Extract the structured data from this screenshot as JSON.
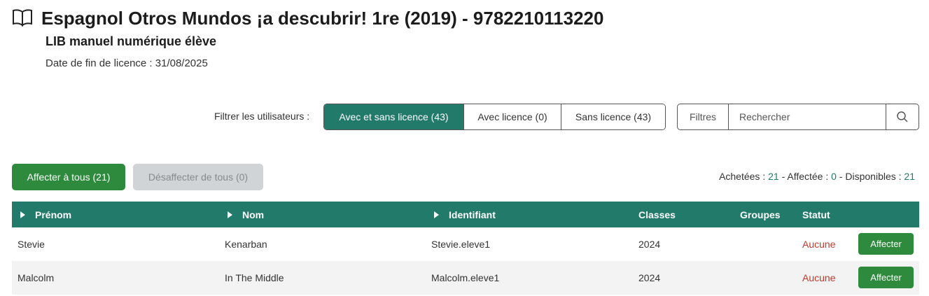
{
  "header": {
    "title": "Espagnol Otros Mundos ¡a descubrir! 1re (2019) - 9782210113220",
    "subtitle": "LIB manuel numérique élève",
    "license_end": "Date de fin de licence : 31/08/2025",
    "icon": "book-icon"
  },
  "filters": {
    "label": "Filtrer les utilisateurs :",
    "options": [
      {
        "label": "Avec et sans licence (43)",
        "active": true
      },
      {
        "label": "Avec licence (0)",
        "active": false
      },
      {
        "label": "Sans licence (43)",
        "active": false
      }
    ]
  },
  "search": {
    "filter_label": "Filtres",
    "placeholder": "Rechercher",
    "icon": "search-icon"
  },
  "actions": {
    "assign_all": "Affecter à tous (21)",
    "unassign_all": "Désaffecter de tous (0)"
  },
  "counts": {
    "bought_label": "Achetées : ",
    "bought": "21",
    "assigned_label": " - Affectée : ",
    "assigned": "0",
    "available_label": " - Disponibles : ",
    "available": "21"
  },
  "table": {
    "columns": [
      "Prénom",
      "Nom",
      "Identifiant",
      "Classes",
      "Groupes",
      "Statut"
    ],
    "rows": [
      {
        "prenom": "Stevie",
        "nom": "Kenarban",
        "identifiant": "Stevie.eleve1",
        "classes": "2024",
        "groupes": "",
        "statut": "Aucune",
        "action": "Affecter"
      },
      {
        "prenom": "Malcolm",
        "nom": "In The Middle",
        "identifiant": "Malcolm.eleve1",
        "classes": "2024",
        "groupes": "",
        "statut": "Aucune",
        "action": "Affecter"
      }
    ]
  },
  "colors": {
    "primary": "#227a6b",
    "action_green": "#2e8b3d",
    "status_red": "#c0392b"
  }
}
